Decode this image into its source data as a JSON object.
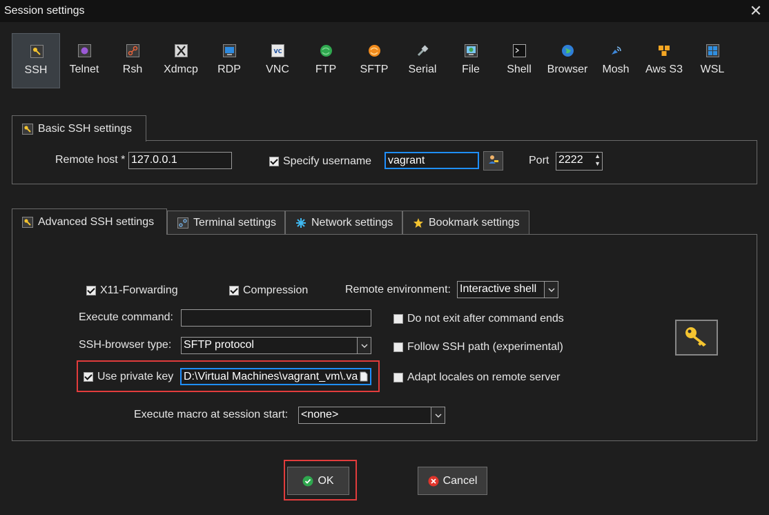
{
  "window": {
    "title": "Session settings",
    "close_glyph": "✕"
  },
  "session_types": [
    {
      "label": "SSH",
      "icon": "ssh-key-icon",
      "selected": true
    },
    {
      "label": "Telnet",
      "icon": "telnet-icon"
    },
    {
      "label": "Rsh",
      "icon": "rsh-icon"
    },
    {
      "label": "Xdmcp",
      "icon": "xdmcp-icon"
    },
    {
      "label": "RDP",
      "icon": "rdp-icon"
    },
    {
      "label": "VNC",
      "icon": "vnc-icon"
    },
    {
      "label": "FTP",
      "icon": "ftp-icon"
    },
    {
      "label": "SFTP",
      "icon": "sftp-icon"
    },
    {
      "label": "Serial",
      "icon": "serial-icon"
    },
    {
      "label": "File",
      "icon": "file-icon"
    },
    {
      "label": "Shell",
      "icon": "shell-icon"
    },
    {
      "label": "Browser",
      "icon": "browser-icon"
    },
    {
      "label": "Mosh",
      "icon": "mosh-icon"
    },
    {
      "label": "Aws S3",
      "icon": "aws-s3-icon"
    },
    {
      "label": "WSL",
      "icon": "wsl-icon"
    }
  ],
  "basic": {
    "tab_label": "Basic SSH settings",
    "remote_host_label": "Remote host *",
    "remote_host_value": "127.0.0.1",
    "specify_username_label": "Specify username",
    "specify_username_checked": true,
    "username_value": "vagrant",
    "port_label": "Port",
    "port_value": "2222"
  },
  "tabs": [
    {
      "label": "Advanced SSH settings",
      "icon": "key-icon",
      "active": true
    },
    {
      "label": "Terminal settings",
      "icon": "terminal-icon"
    },
    {
      "label": "Network settings",
      "icon": "network-icon"
    },
    {
      "label": "Bookmark settings",
      "icon": "star-icon"
    }
  ],
  "advanced": {
    "x11_label": "X11-Forwarding",
    "x11_checked": true,
    "compression_label": "Compression",
    "compression_checked": true,
    "remote_env_label": "Remote environment:",
    "remote_env_value": "Interactive shell",
    "execute_command_label": "Execute command:",
    "execute_command_value": "",
    "do_not_exit_label": "Do not exit after command ends",
    "do_not_exit_checked": false,
    "ssh_browser_label": "SSH-browser type:",
    "ssh_browser_value": "SFTP protocol",
    "follow_ssh_label": "Follow SSH path (experimental)",
    "follow_ssh_checked": false,
    "use_private_key_label": "Use private key",
    "use_private_key_checked": true,
    "private_key_value": "D:\\Virtual Machines\\vagrant_vm\\.va",
    "adapt_locales_label": "Adapt locales on remote server",
    "adapt_locales_checked": false,
    "macro_label": "Execute macro at session start:",
    "macro_value": "<none>"
  },
  "buttons": {
    "ok": "OK",
    "cancel": "Cancel"
  },
  "colors": {
    "accent_focus": "#1f8fff",
    "highlight_box": "#e23c3c",
    "ok_green": "#2fa84f",
    "cancel_red": "#e0352b"
  }
}
